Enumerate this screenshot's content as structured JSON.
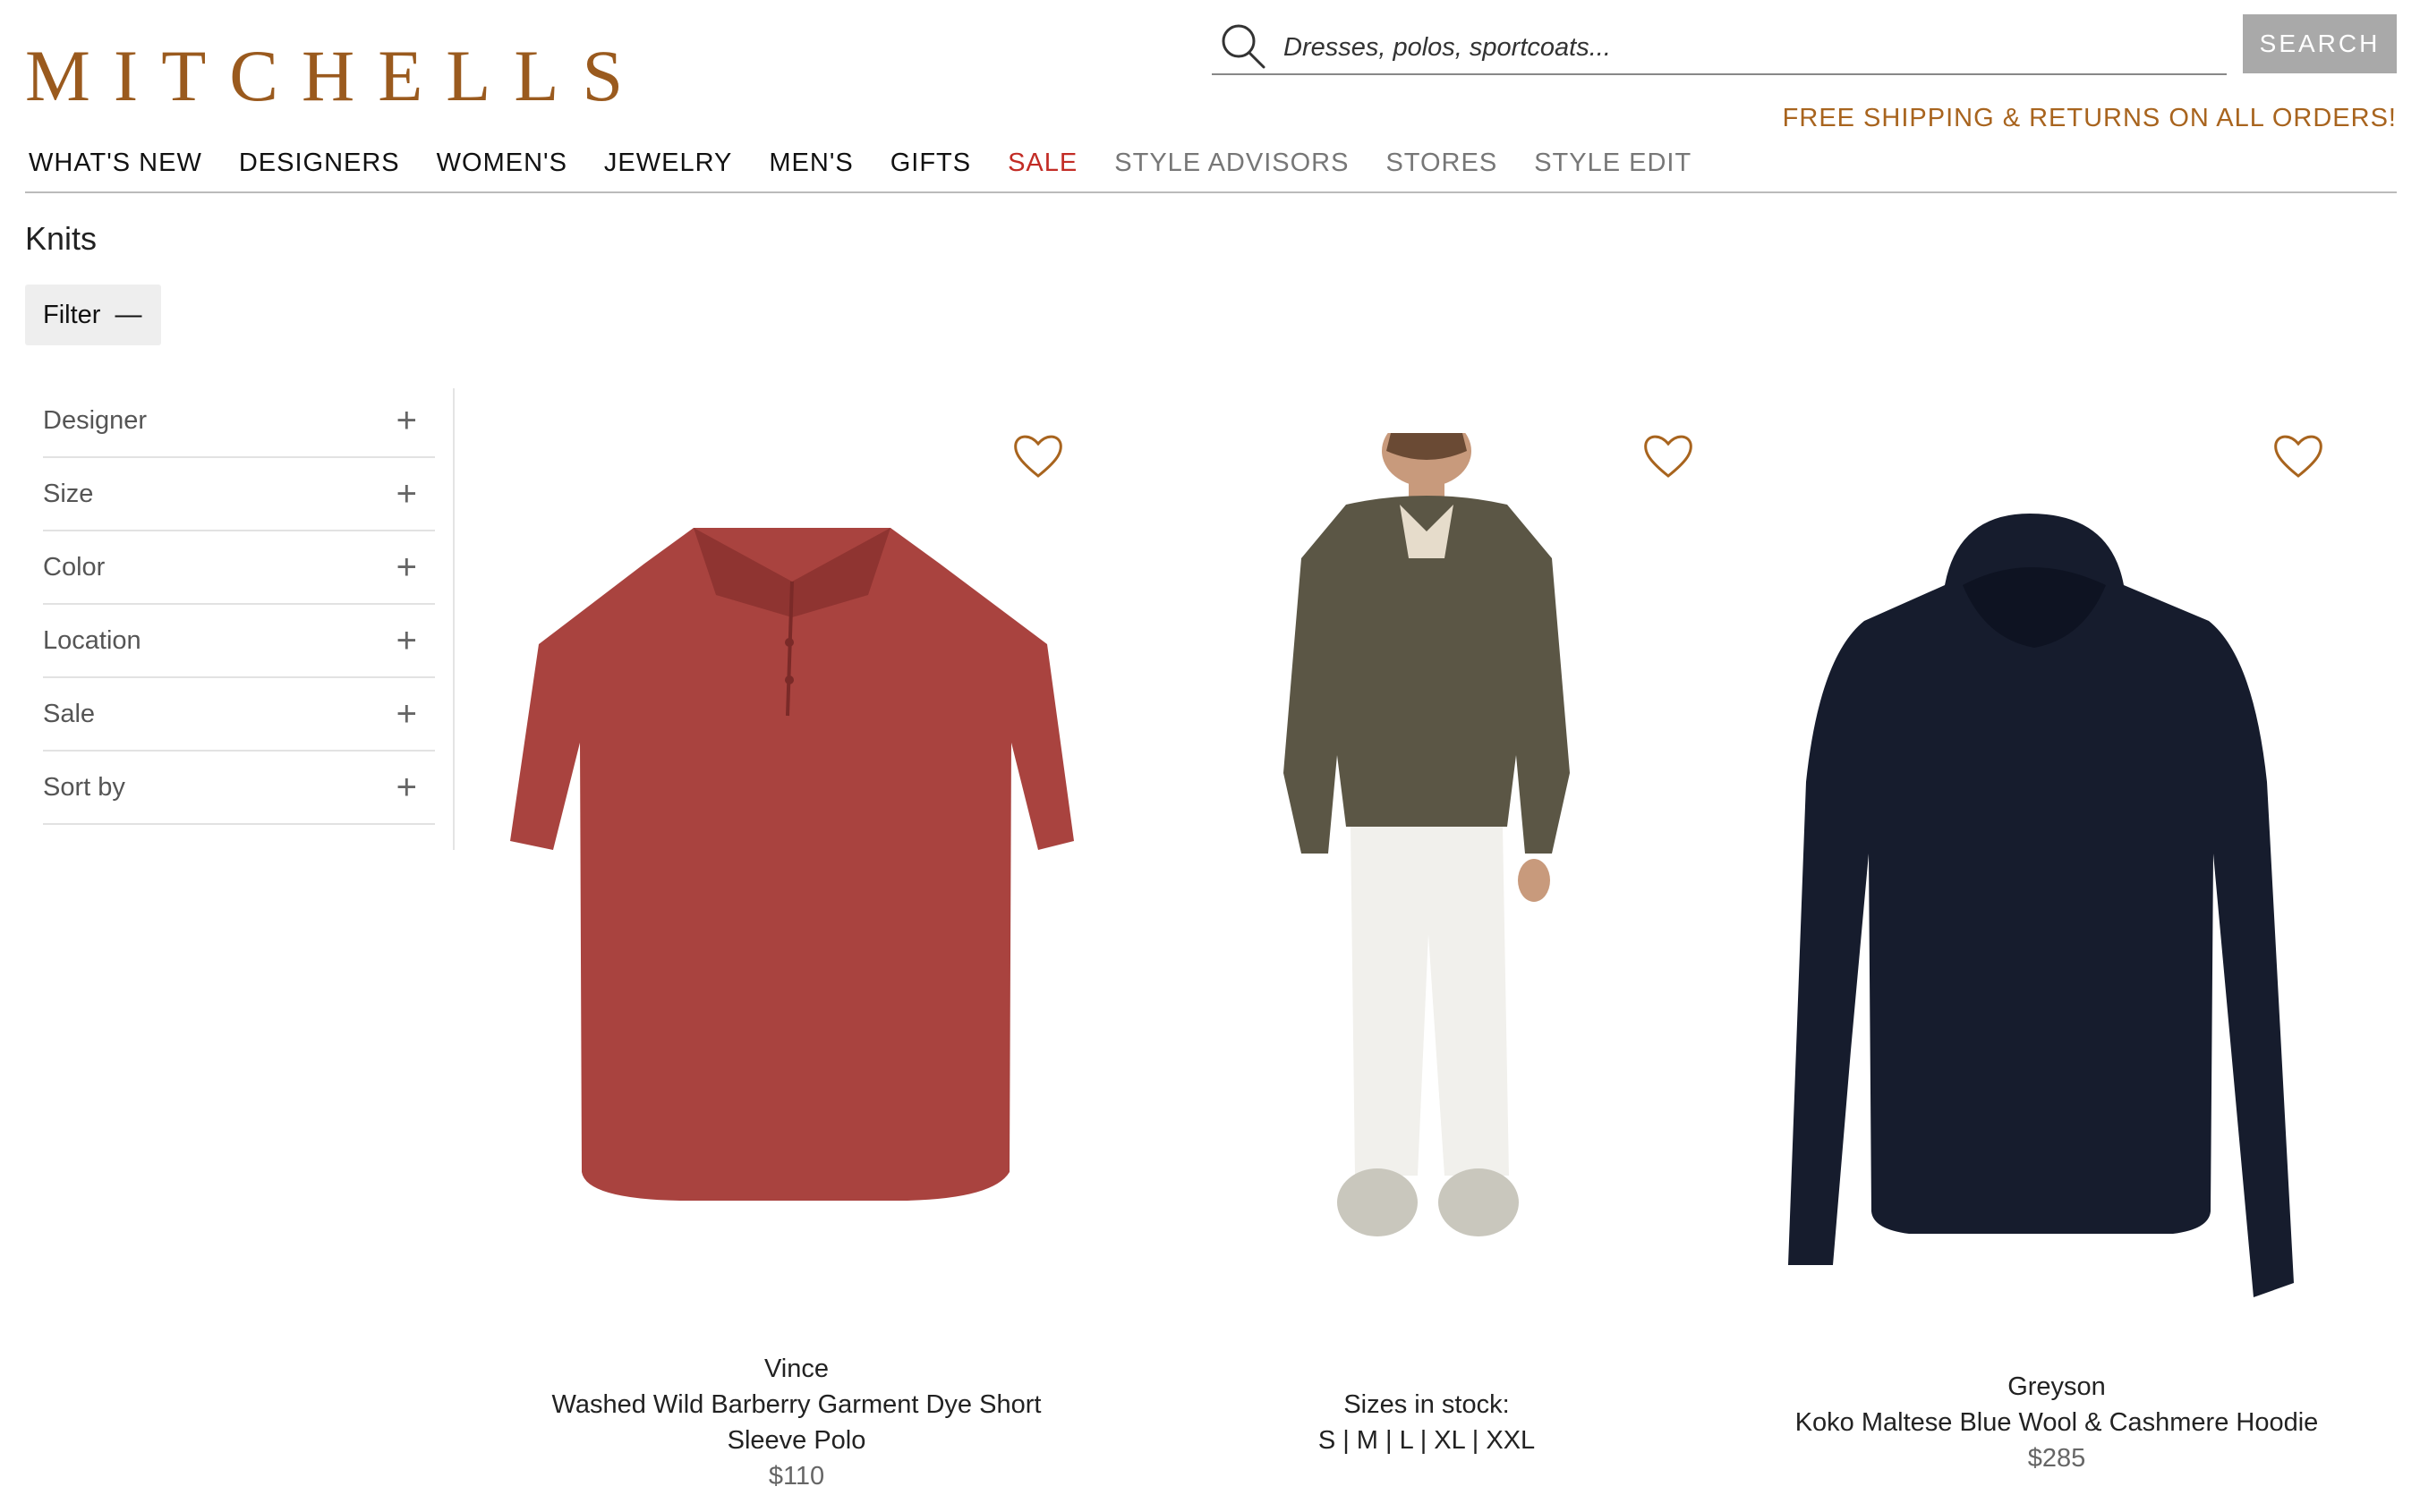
{
  "header": {
    "logo": "MITCHELLS",
    "search": {
      "placeholder": "Dresses, polos, sportcoats...",
      "button_label": "SEARCH"
    },
    "promo": "FREE SHIPPING & RETURNS ON ALL ORDERS!"
  },
  "nav": {
    "items": [
      {
        "label": "WHAT'S NEW"
      },
      {
        "label": "DESIGNERS"
      },
      {
        "label": "WOMEN'S"
      },
      {
        "label": "JEWELRY"
      },
      {
        "label": "MEN'S"
      },
      {
        "label": "GIFTS"
      },
      {
        "label": "SALE"
      },
      {
        "label": "STYLE ADVISORS"
      },
      {
        "label": "STORES"
      },
      {
        "label": "STYLE EDIT"
      }
    ]
  },
  "page": {
    "title": "Knits",
    "filter_label": "Filter"
  },
  "filters": [
    {
      "label": "Designer"
    },
    {
      "label": "Size"
    },
    {
      "label": "Color"
    },
    {
      "label": "Location"
    },
    {
      "label": "Sale"
    },
    {
      "label": "Sort by"
    }
  ],
  "products": [
    {
      "brand": "Vince",
      "name_line1": "Washed Wild Barberry Garment Dye Short",
      "name_line2": "Sleeve Polo",
      "price": "$110"
    },
    {
      "sizes_label": "Sizes in stock:",
      "sizes": "S | M | L | XL | XXL"
    },
    {
      "brand": "Greyson",
      "name": "Koko Maltese Blue Wool & Cashmere Hoodie",
      "price": "$285"
    }
  ],
  "colors": {
    "brand": "#9a5a1e",
    "promo": "#a8641e",
    "sale": "#c22c25",
    "search_button": "#a9a9a9",
    "heart": "#a8641e"
  }
}
